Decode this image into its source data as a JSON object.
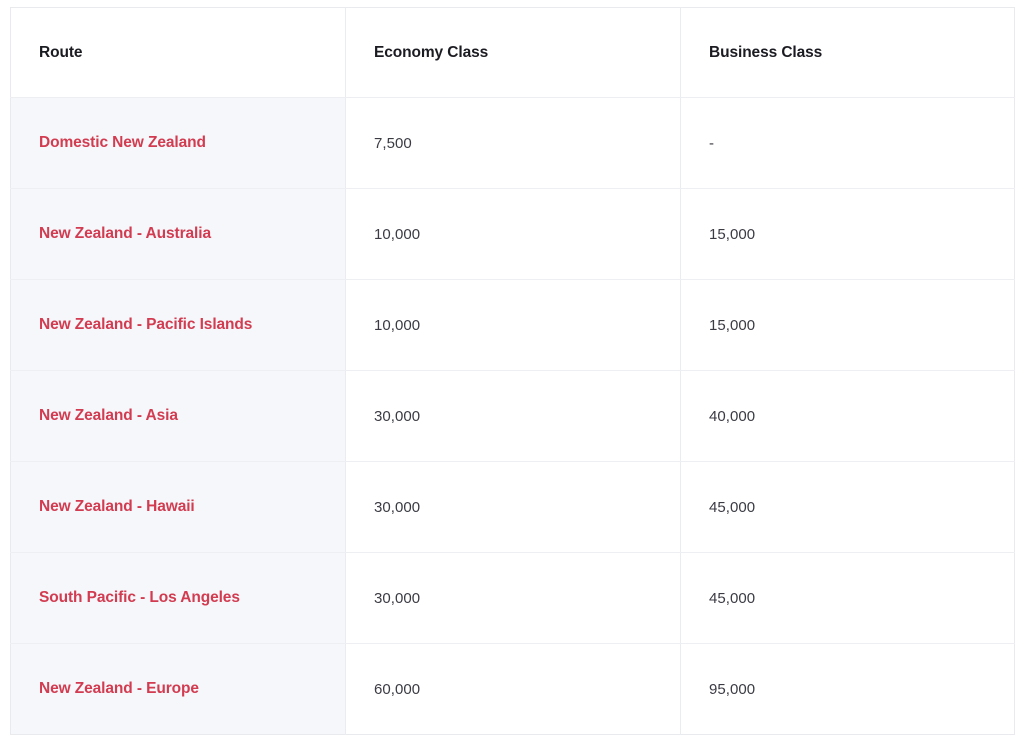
{
  "table": {
    "name": "airpoints-award-chart",
    "columns": [
      {
        "key": "route",
        "label": "Route"
      },
      {
        "key": "economy",
        "label": "Economy Class"
      },
      {
        "key": "business",
        "label": "Business Class"
      }
    ],
    "rows": [
      {
        "route": "Domestic New Zealand",
        "economy": "7,500",
        "business": "-"
      },
      {
        "route": "New Zealand - Australia",
        "economy": "10,000",
        "business": "15,000"
      },
      {
        "route": "New Zealand - Pacific Islands",
        "economy": "10,000",
        "business": "15,000"
      },
      {
        "route": "New Zealand - Asia",
        "economy": "30,000",
        "business": "40,000"
      },
      {
        "route": "New Zealand - Hawaii",
        "economy": "30,000",
        "business": "45,000"
      },
      {
        "route": "South Pacific - Los Angeles",
        "economy": "30,000",
        "business": "45,000"
      },
      {
        "route": "New Zealand - Europe",
        "economy": "60,000",
        "business": "95,000"
      }
    ]
  },
  "colors": {
    "route_link": "#d23b50",
    "header_text": "#1b1b22",
    "value_text": "#3b3b44",
    "route_cell_bg": "#f5f7fa",
    "cell_bg": "#ffffff",
    "border": "#ebecf0"
  },
  "chart_data": {
    "type": "table",
    "title": "",
    "columns": [
      "Route",
      "Economy Class",
      "Business Class"
    ],
    "rows": [
      [
        "Domestic New Zealand",
        "7,500",
        "-"
      ],
      [
        "New Zealand - Australia",
        "10,000",
        "15,000"
      ],
      [
        "New Zealand - Pacific Islands",
        "10,000",
        "15,000"
      ],
      [
        "New Zealand - Asia",
        "30,000",
        "40,000"
      ],
      [
        "New Zealand - Hawaii",
        "30,000",
        "45,000"
      ],
      [
        "South Pacific - Los Angeles",
        "30,000",
        "45,000"
      ],
      [
        "New Zealand - Europe",
        "60,000",
        "95,000"
      ]
    ],
    "values": {
      "economy": [
        7500,
        10000,
        10000,
        30000,
        30000,
        30000,
        60000
      ],
      "business": [
        null,
        15000,
        15000,
        40000,
        45000,
        45000,
        95000
      ]
    }
  }
}
